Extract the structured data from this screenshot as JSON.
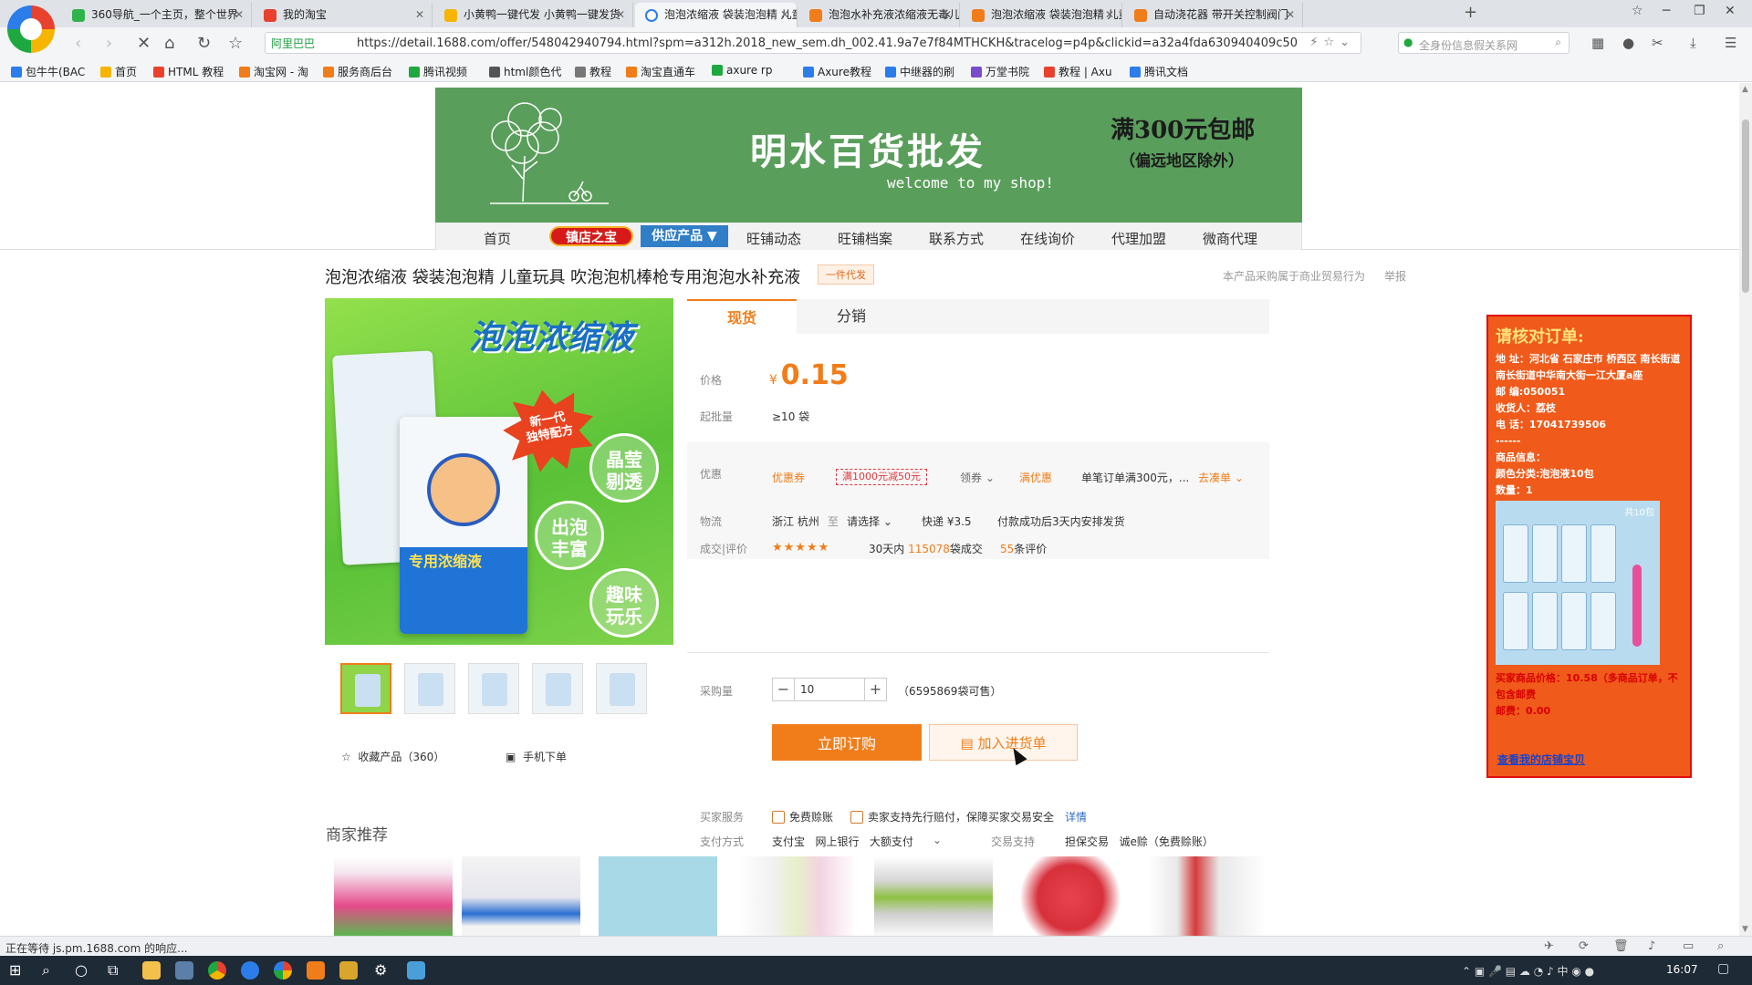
{
  "browser": {
    "tabs": [
      {
        "label": "360导航_一个主页，整个世界",
        "color": "#2fb34a"
      },
      {
        "label": "我的淘宝",
        "color": "#e8412e"
      },
      {
        "label": "小黄鸭一键代发 小黄鸭一键发货",
        "color": "#f6b500"
      },
      {
        "label": "泡泡浓缩液 袋装泡泡精 儿童玩具",
        "color": "#ffffff"
      },
      {
        "label": "泡泡水补充液浓缩液无毒儿童",
        "color": "#f07d1a"
      },
      {
        "label": "泡泡浓缩液 袋装泡泡精 儿童",
        "color": "#f07d1a"
      },
      {
        "label": "自动浇花器 带开关控制阀门",
        "color": "#f07d1a"
      }
    ],
    "new_tab": "+",
    "address": {
      "security_label": "阿里巴巴",
      "url": "https://detail.1688.com/offer/548042940794.html?spm=a312h.2018_new_sem.dh_002.41.9a7e7f84MTHCKH&tracelog=p4p&clickid=a32a4fda630940409c50"
    },
    "search_placeholder": "全身份信息假关系网",
    "bookmarks": [
      {
        "label": "包牛牛(BAC",
        "color": "#2b7de9"
      },
      {
        "label": "首页",
        "color": "#f6b500"
      },
      {
        "label": "HTML 教程",
        "color": "#e8412e"
      },
      {
        "label": "淘宝网 - 淘",
        "color": "#f07d1a"
      },
      {
        "label": "服务商后台",
        "color": "#f07d1a"
      },
      {
        "label": "腾讯视频",
        "color": "#1fa83f"
      },
      {
        "label": "html颜色代",
        "color": "#555555"
      },
      {
        "label": "教程",
        "color": "#777777"
      },
      {
        "label": "淘宝直通车",
        "color": "#f07d1a"
      },
      {
        "label": "axure rp",
        "color": "#1fa83f"
      },
      {
        "label": "Axure教程",
        "color": "#2b7de9"
      },
      {
        "label": "中继器的刷",
        "color": "#2b7de9"
      },
      {
        "label": "万堂书院",
        "color": "#7a4cc9"
      },
      {
        "label": "教程 | Axu",
        "color": "#e8412e"
      },
      {
        "label": "腾讯文档",
        "color": "#2b7de9"
      }
    ]
  },
  "shop": {
    "name": "明水百货批发",
    "welcome": "welcome to my  shop!",
    "free_shipping": "满300元包邮",
    "free_shipping_note": "（偏远地区除外）",
    "nav": {
      "home": "首页",
      "treasure": "镇店之宝",
      "supply": "供应产品 ▼",
      "news": "旺铺动态",
      "archive": "旺铺档案",
      "contact": "联系方式",
      "inquiry": "在线询价",
      "agent_join": "代理加盟",
      "wechat_agent": "微商代理"
    }
  },
  "product": {
    "title": "泡泡浓缩液 袋装泡泡精 儿童玩具 吹泡泡机棒枪专用泡泡水补充液",
    "tag": "一件代发",
    "note": "本产品采购属于商业贸易行为",
    "report": "举报",
    "image": {
      "headline": "泡泡浓缩液",
      "burst": "新一代\n独特配方",
      "bubble1": "晶莹\n剔透",
      "bubble2": "出泡\n丰富",
      "bubble3": "趣味\n玩乐",
      "sachet_label": "专用浓缩液"
    },
    "favorite": "收藏产品（360）",
    "mobile_order": "手机下单",
    "tabs": {
      "spot": "现货",
      "distribution": "分销"
    },
    "price_label": "价格",
    "currency": "¥",
    "price": "0.15",
    "moq_label": "起批量",
    "moq": "≥10 袋",
    "promo_label": "优惠",
    "coupon": "优惠券",
    "coupon_offer": "满1000元减50元",
    "claim": "领券",
    "full_discount": "满优惠",
    "full_discount_text": "单笔订单满300元，...",
    "go_order": "去凑单",
    "logistics_label": "物流",
    "origin": "浙江 杭州",
    "to": "至",
    "dest_select": "请选择",
    "express": "快递 ¥3.5",
    "ship_time": "付款成功后3天内安排发货",
    "reviews_label": "成交|评价",
    "stars": "★★★★★",
    "sales_prefix": "30天内",
    "sales_count": "115078",
    "sales_suffix": "袋成交",
    "review_count": "55",
    "review_suffix": "条评价",
    "qty_label": "采购量",
    "qty_minus": "−",
    "qty_plus": "+",
    "qty_value": "10",
    "stock": "（6595869袋可售）",
    "buy_now": "立即订购",
    "add_cart": "加入进货单",
    "service_label": "买家服务",
    "service1": "免费赊账",
    "service2": "卖家支持先行赔付，保障买家交易安全",
    "service_detail": "详情",
    "payment_label": "支付方式",
    "payments": "支付宝   网上银行   大额支付",
    "trade_label": "交易支持",
    "trade_support": "担保交易   诚e赊（免费赊账）"
  },
  "recommend_title": "商家推荐",
  "order_panel": {
    "title": "请核对订单:",
    "address": "地  址：河北省 石家庄市 桥西区 南长街道 南长街道中华南大街一江大厦a座",
    "zip": "邮  编:050051",
    "receiver": "收货人：荔枝",
    "phone": "电  话：17041739506",
    "sep": "------",
    "goods_title": "商品信息：",
    "color": "颜色分类:泡泡液10包",
    "count": "数量：1",
    "img_tag": "共10包",
    "price_line": "买家商品价格：10.58（多商品订单，不包含邮费",
    "postage": "邮费：0.00",
    "link": "查看我的店铺宝贝"
  },
  "status_text": "正在等待 js.pm.1688.com 的响应...",
  "clock": "16:07"
}
